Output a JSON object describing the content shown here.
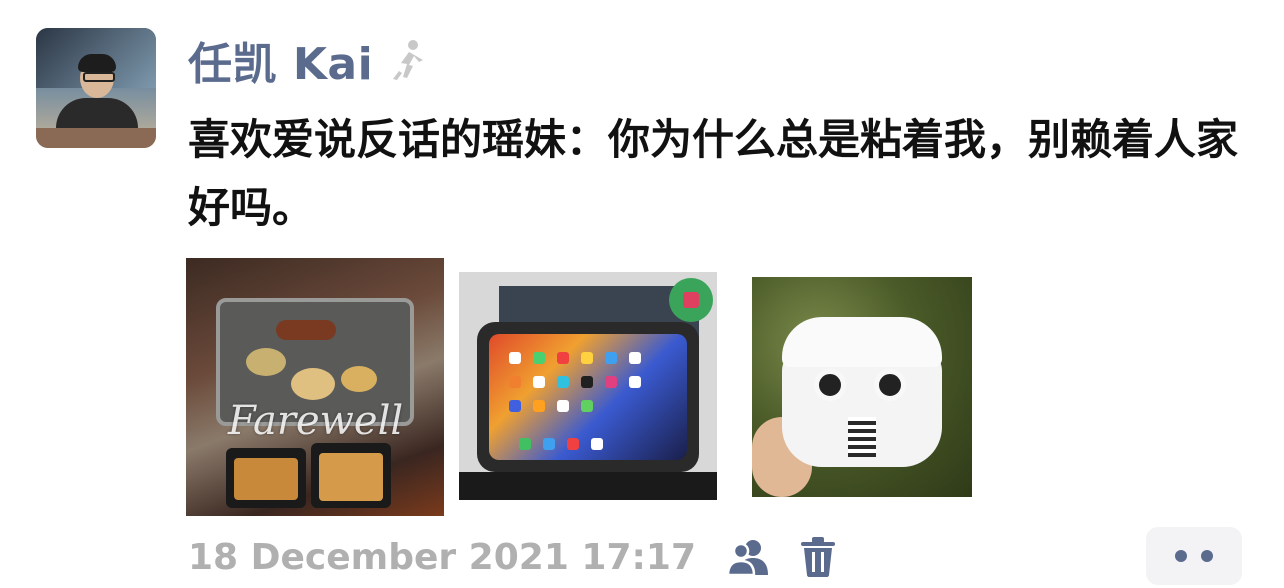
{
  "post": {
    "author": "任凯 Kai",
    "text": "喜欢爱说反话的瑶妹：你为什么总是粘着我，别赖着人家好吗。",
    "photos": [
      {
        "name": "bbq-photo",
        "overlay_text": "Farewell"
      },
      {
        "name": "ipad-photo"
      },
      {
        "name": "airpods-photo"
      }
    ],
    "timestamp": "18 December 2021 17:17"
  },
  "icons": {
    "author_badge": "walking-person-icon",
    "visibility": "people-icon",
    "delete": "trash-icon",
    "more": "more-dots-icon"
  },
  "colors": {
    "name": "#5b6b8e",
    "timestamp": "#b0b0b0",
    "accent": "#5b6b8e",
    "more_bg": "#f3f3f5"
  }
}
